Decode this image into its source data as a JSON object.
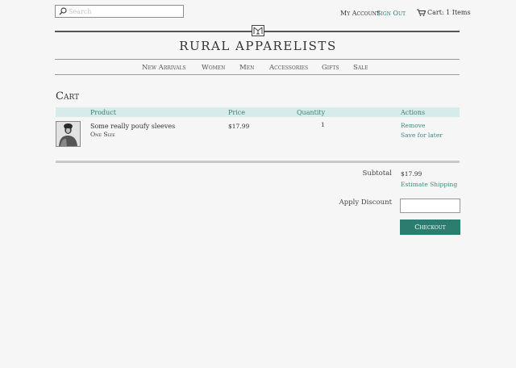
{
  "header": {
    "search_placeholder": "Search",
    "my_account": "My Account",
    "sign_out": "Sign Out",
    "cart_text": "Cart: 1 Items",
    "brand": "RURAL APPARELISTS"
  },
  "nav": {
    "items": [
      "New Arrivals",
      "Women",
      "Men",
      "Accessories",
      "Gifts",
      "Sale"
    ]
  },
  "cart": {
    "title": "Cart",
    "columns": {
      "product": "Product",
      "price": "Price",
      "quantity": "Quantity",
      "actions": "Actions"
    },
    "items": [
      {
        "name": "Some really poufy sleeves",
        "size": "One Size",
        "price": "$17.99",
        "quantity": "1",
        "remove": "Remove",
        "save_for_later": "Save for later"
      }
    ]
  },
  "summary": {
    "subtotal_label": "Subtotal",
    "subtotal_value": "$17.99",
    "estimate_shipping": "Estimate Shipping",
    "apply_discount_label": "Apply Discount",
    "discount_value": "",
    "checkout_label": "Checkout"
  },
  "colors": {
    "accent": "#2c7d70",
    "table_header_bg": "#d6ecea",
    "page_bg": "#f6f6f6"
  },
  "icons": [
    "search-icon",
    "cart-icon",
    "logo-mark"
  ]
}
